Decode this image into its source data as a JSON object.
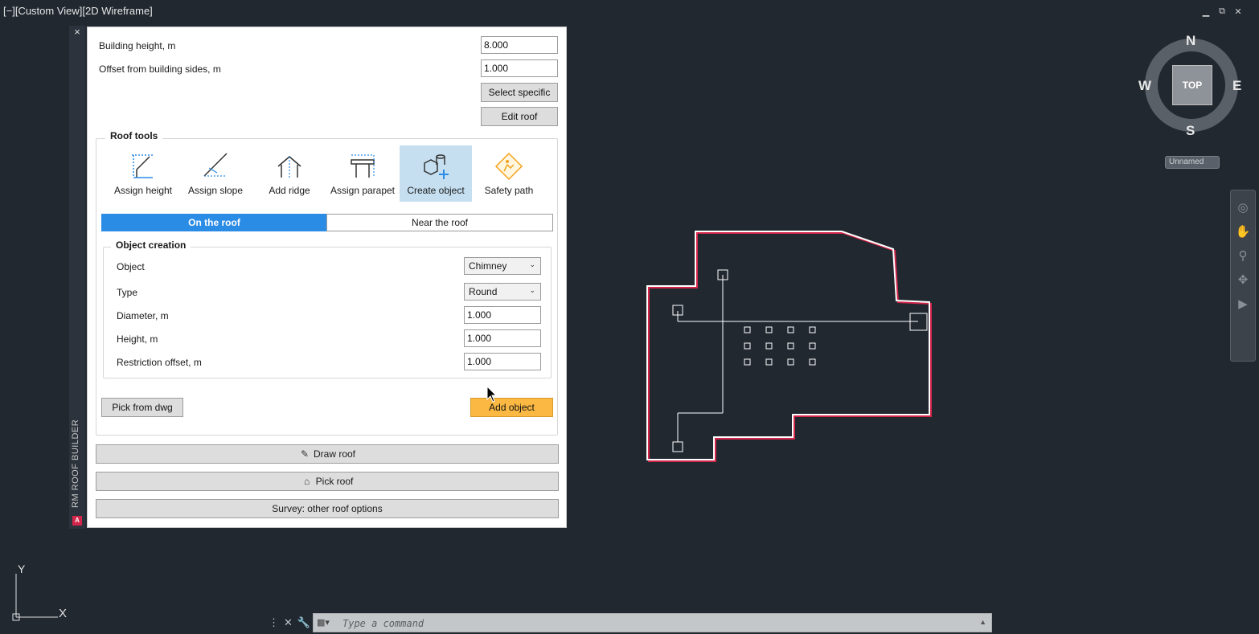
{
  "viewport": {
    "label": "[−][Custom View][2D Wireframe]"
  },
  "window_controls": {
    "minimize": "▁",
    "restore": "⧉",
    "close": "✕"
  },
  "palette": {
    "title": "RM ROOF BUILDER",
    "close": "×",
    "logo": "A",
    "building_height_label": "Building height, m",
    "building_height_value": "8.000",
    "offset_label": "Offset from building sides, m",
    "offset_value": "1.000",
    "select_specific": "Select specific",
    "edit_roof": "Edit roof",
    "roof_tools_title": "Roof tools",
    "tools": [
      {
        "label": "Assign height",
        "icon": "assign-height-icon"
      },
      {
        "label": "Assign slope",
        "icon": "assign-slope-icon"
      },
      {
        "label": "Add ridge",
        "icon": "add-ridge-icon"
      },
      {
        "label": "Assign parapet",
        "icon": "assign-parapet-icon"
      },
      {
        "label": "Create object",
        "icon": "create-object-icon"
      },
      {
        "label": "Safety path",
        "icon": "safety-path-icon"
      }
    ],
    "tabs": [
      {
        "label": "On the roof",
        "active": true
      },
      {
        "label": "Near the roof",
        "active": false
      }
    ],
    "object_creation_title": "Object creation",
    "object_label": "Object",
    "object_value": "Chimney",
    "type_label": "Type",
    "type_value": "Round",
    "diameter_label": "Diameter, m",
    "diameter_value": "1.000",
    "height_label": "Height, m",
    "height_value": "1.000",
    "restriction_label": "Restriction offset, m",
    "restriction_value": "1.000",
    "pick_from_dwg": "Pick from dwg",
    "add_object": "Add object",
    "draw_roof": "Draw roof",
    "pick_roof": "Pick roof",
    "survey": "Survey: other roof options"
  },
  "viewcube": {
    "n": "N",
    "s": "S",
    "e": "E",
    "w": "W",
    "top": "TOP",
    "ucs": "Unnamed"
  },
  "command_line": {
    "placeholder": "Type a command"
  },
  "ucs": {
    "y": "Y",
    "x": "X"
  },
  "colors": {
    "accent": "#2b8ce6",
    "add_button": "#fbb943",
    "active_tool": "#c5dff0",
    "roof_outline": "#d4264a",
    "background": "#212830"
  }
}
